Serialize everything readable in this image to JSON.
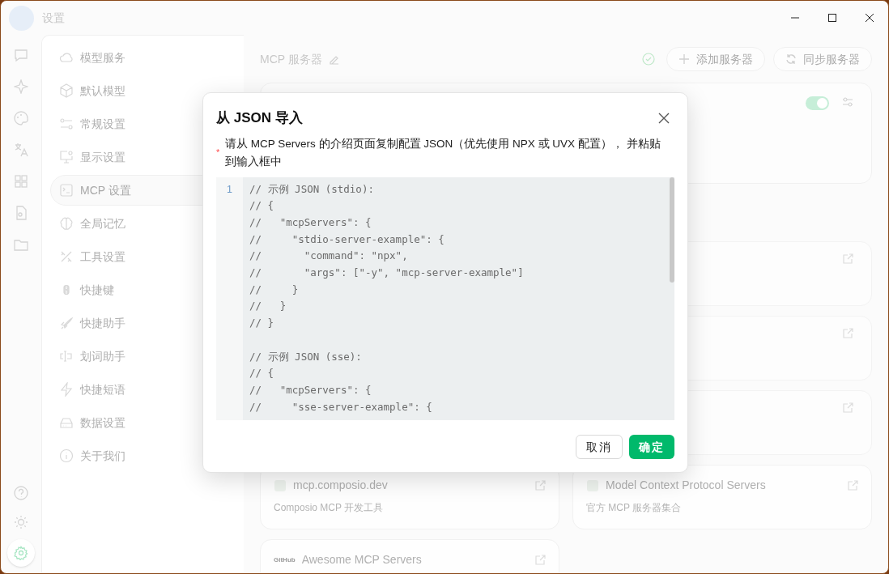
{
  "window": {
    "title": "设置"
  },
  "rail": {
    "top": [
      {
        "selected": false
      },
      {
        "selected": false
      },
      {
        "selected": false
      },
      {
        "selected": false
      },
      {
        "selected": false
      },
      {
        "selected": false
      },
      {
        "selected": false
      }
    ],
    "bottom": [
      {
        "selected": false
      },
      {
        "selected": false
      },
      {
        "selected": true
      }
    ]
  },
  "menu": [
    {
      "label": "模型服务",
      "selected": false
    },
    {
      "label": "默认模型",
      "selected": false
    },
    {
      "label": "常规设置",
      "selected": false
    },
    {
      "label": "显示设置",
      "selected": false
    },
    {
      "label": "MCP 设置",
      "selected": true
    },
    {
      "label": "全局记忆",
      "selected": false
    },
    {
      "label": "工具设置",
      "selected": false
    },
    {
      "label": "快捷键",
      "selected": false
    },
    {
      "label": "快捷助手",
      "selected": false
    },
    {
      "label": "划词助手",
      "selected": false
    },
    {
      "label": "快捷短语",
      "selected": false
    },
    {
      "label": "数据设置",
      "selected": false
    },
    {
      "label": "关于我们",
      "selected": false
    }
  ],
  "header": {
    "title": "MCP 服务器",
    "buttons": [
      "添加服务器",
      "同步服务器"
    ]
  },
  "server_card": {
    "on": true
  },
  "resource_cards": [
    {
      "title": "mcp.composio.dev",
      "description": "Composio MCP 开发工具"
    },
    {
      "title": "Model Context Protocol Servers",
      "description": "官方 MCP 服务器集合"
    },
    {
      "logo": "GitHub",
      "title": "Awesome MCP Servers"
    }
  ],
  "dialog": {
    "title": "从 JSON 导入",
    "required_mark": "*",
    "label": "请从 MCP Servers 的介绍页面复制配置 JSON（优先使用 NPX 或 UVX 配置）， 并粘贴到输入框中",
    "line_numbers": [
      "1"
    ],
    "code": "// 示例 JSON (stdio):\n// {\n//   \"mcpServers\": {\n//     \"stdio-server-example\": {\n//       \"command\": \"npx\",\n//       \"args\": [\"-y\", \"mcp-server-example\"]\n//     }\n//   }\n// }\n\n// 示例 JSON (sse):\n// {\n//   \"mcpServers\": {\n//     \"sse-server-example\": {",
    "buttons": [
      {
        "label": "取消",
        "kind": "secondary"
      },
      {
        "label": "确定",
        "kind": "primary"
      }
    ]
  }
}
